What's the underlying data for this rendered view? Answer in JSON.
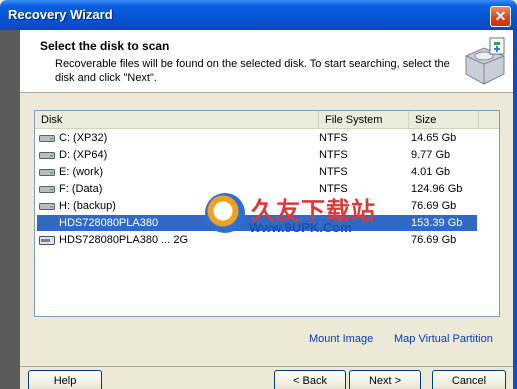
{
  "window": {
    "title": "Recovery Wizard",
    "close_glyph": "✕"
  },
  "header": {
    "title": "Select the disk to scan",
    "description": "Recoverable files will be found on the selected disk. To start searching, select the disk and click \"Next\".",
    "icon": "disk-wizard-icon"
  },
  "list": {
    "columns": [
      "Disk",
      "File System",
      "Size"
    ],
    "rows": [
      {
        "disk": "C: (XP32)",
        "fs": "NTFS",
        "size": "14.65 Gb",
        "icon": "partition-icon"
      },
      {
        "disk": "D: (XP64)",
        "fs": "NTFS",
        "size": "9.77 Gb",
        "icon": "partition-icon"
      },
      {
        "disk": "E: (work)",
        "fs": "NTFS",
        "size": "4.01 Gb",
        "icon": "partition-icon"
      },
      {
        "disk": "F: (Data)",
        "fs": "NTFS",
        "size": "124.96 Gb",
        "icon": "partition-icon"
      },
      {
        "disk": "H: (backup)",
        "fs": "",
        "size": "76.69 Gb",
        "icon": "partition-icon"
      },
      {
        "disk": "HDS728080PLA380",
        "fs": "",
        "size": "153.39 Gb",
        "icon": "hard-drive-icon",
        "selected": true
      },
      {
        "disk": "HDS728080PLA380 ... 2G",
        "fs": "",
        "size": "76.69 Gb",
        "icon": "hard-drive-icon"
      }
    ]
  },
  "watermark": {
    "text_cn": "久友下载站",
    "url": "Www.9UPK.Com"
  },
  "links": {
    "mount_image": "Mount Image",
    "map_partition": "Map Virtual Partition"
  },
  "buttons": {
    "help": "Help",
    "back": "< Back",
    "next": "Next >",
    "cancel": "Cancel"
  },
  "colors": {
    "selection": "#316ac5",
    "title_bar": "#0a5fe0",
    "link": "#0a3cb8"
  }
}
